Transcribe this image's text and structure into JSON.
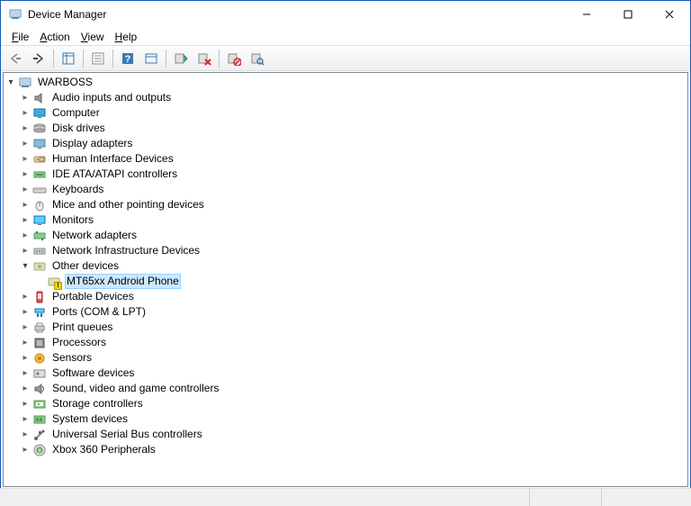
{
  "window": {
    "title": "Device Manager"
  },
  "menu": {
    "file": "File",
    "action": "Action",
    "view": "View",
    "help": "Help"
  },
  "tree": {
    "root": "WARBOSS",
    "categories": [
      {
        "label": "Audio inputs and outputs",
        "icon": "speaker",
        "expanded": false
      },
      {
        "label": "Computer",
        "icon": "monitor",
        "expanded": false
      },
      {
        "label": "Disk drives",
        "icon": "disk",
        "expanded": false
      },
      {
        "label": "Display adapters",
        "icon": "display",
        "expanded": false
      },
      {
        "label": "Human Interface Devices",
        "icon": "hid",
        "expanded": false
      },
      {
        "label": "IDE ATA/ATAPI controllers",
        "icon": "ide",
        "expanded": false
      },
      {
        "label": "Keyboards",
        "icon": "keyboard",
        "expanded": false
      },
      {
        "label": "Mice and other pointing devices",
        "icon": "mouse",
        "expanded": false
      },
      {
        "label": "Monitors",
        "icon": "monitor2",
        "expanded": false
      },
      {
        "label": "Network adapters",
        "icon": "net",
        "expanded": false
      },
      {
        "label": "Network Infrastructure Devices",
        "icon": "netinfra",
        "expanded": false
      },
      {
        "label": "Other devices",
        "icon": "other",
        "expanded": true,
        "children": [
          {
            "label": "MT65xx Android Phone",
            "icon": "unknown",
            "selected": true,
            "warning": true
          }
        ]
      },
      {
        "label": "Portable Devices",
        "icon": "portable",
        "expanded": false
      },
      {
        "label": "Ports (COM & LPT)",
        "icon": "ports",
        "expanded": false
      },
      {
        "label": "Print queues",
        "icon": "printer",
        "expanded": false
      },
      {
        "label": "Processors",
        "icon": "cpu",
        "expanded": false
      },
      {
        "label": "Sensors",
        "icon": "sensor",
        "expanded": false
      },
      {
        "label": "Software devices",
        "icon": "software",
        "expanded": false
      },
      {
        "label": "Sound, video and game controllers",
        "icon": "sound",
        "expanded": false
      },
      {
        "label": "Storage controllers",
        "icon": "storage",
        "expanded": false
      },
      {
        "label": "System devices",
        "icon": "system",
        "expanded": false
      },
      {
        "label": "Universal Serial Bus controllers",
        "icon": "usb",
        "expanded": false
      },
      {
        "label": "Xbox 360 Peripherals",
        "icon": "xbox",
        "expanded": false
      }
    ]
  }
}
